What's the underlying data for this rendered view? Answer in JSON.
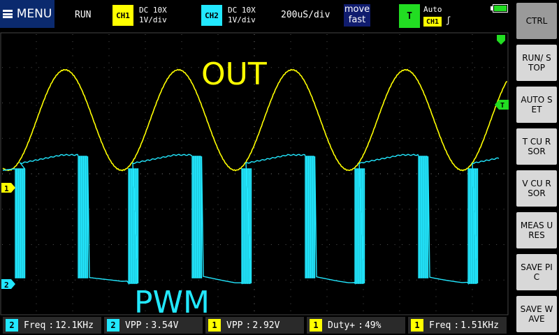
{
  "topbar": {
    "menu_label": "MENU",
    "run_status": "RUN",
    "ch1": {
      "tag": "CH1",
      "coupling": "DC  10X",
      "scale": "1V/div",
      "color": "#ffff00"
    },
    "ch2": {
      "tag": "CH2",
      "coupling": "DC  10X",
      "scale": "1V/div",
      "color": "#22e8ff"
    },
    "timebase": "200uS/div",
    "move_mode": [
      "move",
      "fast"
    ],
    "trigger": {
      "tag": "T",
      "mode": "Auto",
      "source": "CH1",
      "edge": "ʃ"
    },
    "battery_icon": "battery-icon"
  },
  "sidebar": [
    {
      "label": "CTRL",
      "name": "ctrl"
    },
    {
      "label": "RUN/ STOP",
      "name": "run-stop"
    },
    {
      "label": "AUTO SET",
      "name": "auto-set"
    },
    {
      "label": "T CU RSOR",
      "name": "t-cursor"
    },
    {
      "label": "V CU RSOR",
      "name": "v-cursor"
    },
    {
      "label": "MEAS URES",
      "name": "measures"
    },
    {
      "label": "SAVE PIC",
      "name": "save-pic"
    },
    {
      "label": "SAVE WAVE",
      "name": "save-wave"
    }
  ],
  "scope": {
    "annotation_top": "OUT",
    "annotation_bottom": "PWM",
    "ch1_marker": "1",
    "ch2_marker": "2",
    "trace_ch1_color": "#ffff00",
    "trace_ch2_color": "#22e8ff"
  },
  "measurements": [
    {
      "ch": "2",
      "label": "Freq",
      "value": "12.1KHz"
    },
    {
      "ch": "2",
      "label": "VPP",
      "value": "3.54V"
    },
    {
      "ch": "1",
      "label": "VPP",
      "value": "2.92V"
    },
    {
      "ch": "1",
      "label": "Duty+",
      "value": "49%"
    },
    {
      "ch": "1",
      "label": "Freq",
      "value": "1.51KHz"
    }
  ]
}
